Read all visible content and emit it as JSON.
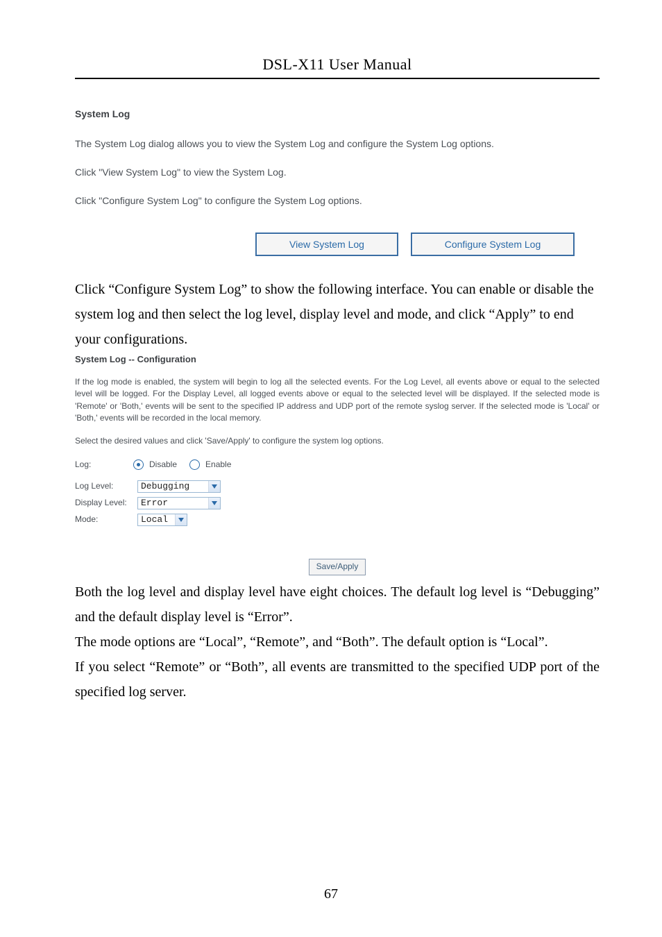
{
  "header": {
    "title": "DSL-X11 User Manual"
  },
  "page_number": "67",
  "syslog_info": {
    "title": "System Log",
    "p1": "The System Log dialog allows you to view the System Log and configure the System Log options.",
    "p2": "Click \"View System Log\" to view the System Log.",
    "p3": "Click \"Configure System Log\" to configure the System Log options.",
    "view_button": "View System Log",
    "configure_button": "Configure System Log"
  },
  "manual_paragraph_1": "Click “Configure System Log” to show the following interface. You can enable or disable the system log and then select the log level, display level and mode, and click “Apply” to end your configurations.",
  "config": {
    "title": "System Log -- Configuration",
    "desc": "If the log mode is enabled, the system will begin to log all the selected events. For the Log Level, all events above or equal to the selected level will be logged. For the Display Level, all logged events above or equal to the selected level will be displayed. If the selected mode is 'Remote' or 'Both,' events will be sent to the specified IP address and UDP port of the remote syslog server. If the selected mode is 'Local' or 'Both,' events will be recorded in the local memory.",
    "instr": "Select the desired values and click 'Save/Apply' to configure the system log options.",
    "log_label": "Log:",
    "disable_label": "Disable",
    "enable_label": "Enable",
    "log_radio_selected": "Disable",
    "log_level_label": "Log Level:",
    "display_level_label": "Display Level:",
    "mode_label": "Mode:",
    "log_level_value": "Debugging",
    "display_level_value": "Error",
    "mode_value": "Local",
    "save_button": "Save/Apply"
  },
  "manual_paragraphs_after": {
    "p1": "Both the log level and display level have eight choices. The default log level is “Debugging” and the default display level is “Error”.",
    "p2": "The mode options are “Local”, “Remote”, and “Both”. The default option is “Local”.",
    "p3": "If you select “Remote” or “Both”, all events are transmitted to the specified UDP port of the specified log server."
  }
}
